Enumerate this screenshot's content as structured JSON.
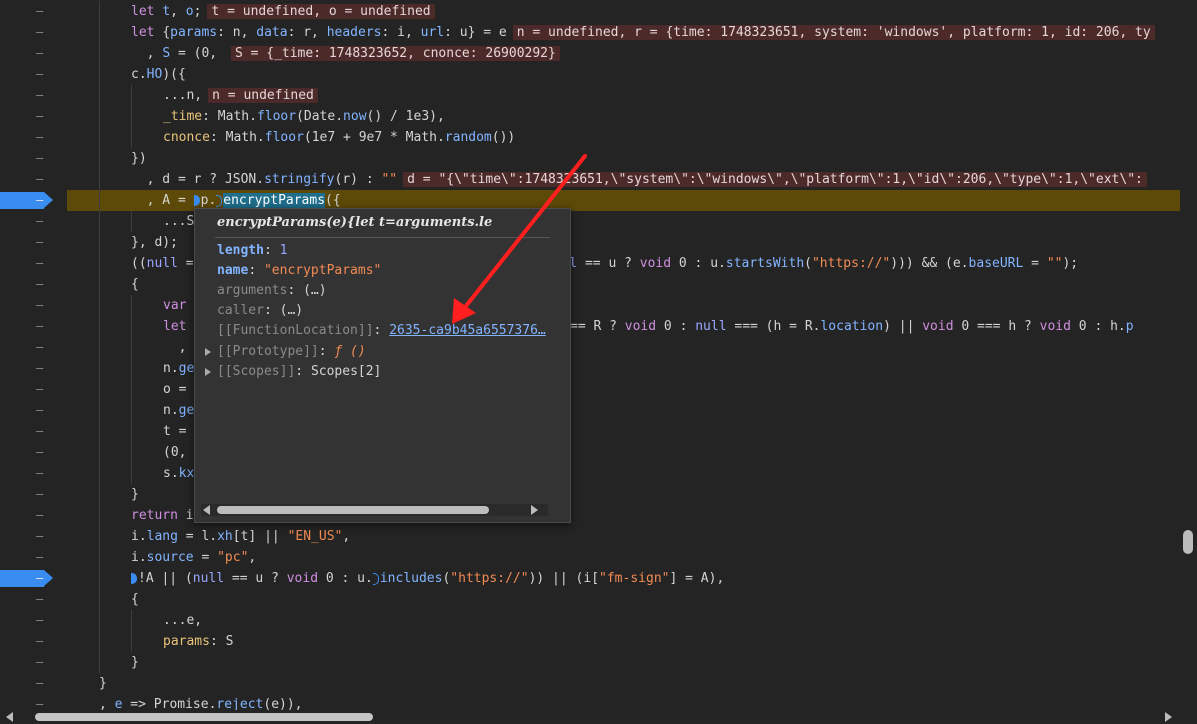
{
  "gutter": {
    "dash": "–",
    "breakpoint_lines": [
      9,
      27
    ]
  },
  "code": {
    "lines": [
      {
        "indent": 2,
        "tokens": [
          [
            "k",
            "let "
          ],
          [
            "v",
            "t"
          ],
          [
            "p",
            ", "
          ],
          [
            "v",
            "o"
          ],
          [
            "p",
            ";"
          ]
        ],
        "inline": "t = undefined, o = undefined"
      },
      {
        "indent": 2,
        "tokens": [
          [
            "k",
            "let "
          ],
          [
            "p",
            "{"
          ],
          [
            "v",
            "params"
          ],
          [
            "p",
            ": n, "
          ],
          [
            "v",
            "data"
          ],
          [
            "p",
            ": r, "
          ],
          [
            "v",
            "headers"
          ],
          [
            "p",
            ": i, "
          ],
          [
            "v",
            "url"
          ],
          [
            "p",
            ": u} = e"
          ]
        ],
        "inline": "n = undefined, r = {time: 1748323651, system: 'windows', platform: 1, id: 206, ty"
      },
      {
        "indent": 2,
        "tokens": [
          [
            "p",
            "  , "
          ],
          [
            "v",
            "S"
          ],
          [
            "p",
            " = (0, "
          ]
        ],
        "inline": "S = {_time: 1748323652, cnonce: 26900292}"
      },
      {
        "indent": 2,
        "tokens": [
          [
            "p",
            "c."
          ],
          [
            "v",
            "HO"
          ],
          [
            "p",
            ")({"
          ]
        ]
      },
      {
        "indent": 3,
        "tokens": [
          [
            "p",
            "...n,"
          ]
        ],
        "inline": "n = undefined"
      },
      {
        "indent": 3,
        "tokens": [
          [
            "f",
            "_time"
          ],
          [
            "p",
            ": Math."
          ],
          [
            "v",
            "floor"
          ],
          [
            "p",
            "(Date."
          ],
          [
            "v",
            "now"
          ],
          [
            "p",
            "() / 1e3),"
          ]
        ]
      },
      {
        "indent": 3,
        "tokens": [
          [
            "f",
            "cnonce"
          ],
          [
            "p",
            ": Math."
          ],
          [
            "v",
            "floor"
          ],
          [
            "p",
            "(1e7 + 9e7 * Math."
          ],
          [
            "v",
            "random"
          ],
          [
            "p",
            "())"
          ]
        ]
      },
      {
        "indent": 2,
        "tokens": [
          [
            "p",
            "})"
          ]
        ]
      },
      {
        "indent": 2,
        "tokens": [
          [
            "p",
            "  , d = r ? JSON."
          ],
          [
            "v",
            "stringify"
          ],
          [
            "p",
            "(r) : "
          ],
          [
            "s",
            "\"\""
          ]
        ],
        "inline": "d = \"{\\\"time\\\":1748323651,\\\"system\\\":\\\"windows\\\",\\\"platform\\\":1,\\\"id\\\":206,\\\"type\\\":1,\\\"ext\\\":"
      },
      {
        "indent": 2,
        "paused": true,
        "tokens": [
          [
            "p",
            "  , A = "
          ],
          [
            "m",
            "solid"
          ],
          [
            "p",
            "p."
          ],
          [
            "m",
            "outline"
          ],
          [
            "sel",
            "encryptParams"
          ],
          [
            "p",
            "({"
          ]
        ]
      },
      {
        "indent": 3,
        "tokens": [
          [
            "p",
            "...S"
          ]
        ]
      },
      {
        "indent": 2,
        "tokens": [
          [
            "p",
            "}, d);"
          ]
        ]
      },
      {
        "indent": 2,
        "tokens": [
          [
            "p",
            "(("
          ],
          [
            "n",
            "null"
          ],
          [
            "p",
            " =                                               "
          ],
          [
            "n",
            "ll"
          ],
          [
            "p",
            " == u ? "
          ],
          [
            "k",
            "void "
          ],
          [
            "p",
            "0 : u."
          ],
          [
            "v",
            "startsWith"
          ],
          [
            "p",
            "("
          ],
          [
            "s",
            "\"https://\""
          ],
          [
            "p",
            "))) && (e."
          ],
          [
            "v",
            "baseURL"
          ],
          [
            "p",
            " = "
          ],
          [
            "s",
            "\"\""
          ],
          [
            "p",
            ");"
          ]
        ]
      },
      {
        "indent": 2,
        "tokens": [
          [
            "p",
            "{"
          ]
        ]
      },
      {
        "indent": 3,
        "tokens": [
          [
            "k",
            "var"
          ]
        ]
      },
      {
        "indent": 3,
        "tokens": [
          [
            "k",
            "let"
          ],
          [
            "p",
            "                                            l 0 === R ? "
          ],
          [
            "k",
            "void "
          ],
          [
            "p",
            "0 : "
          ],
          [
            "n",
            "null"
          ],
          [
            "p",
            " === (h = R."
          ],
          [
            "v",
            "location"
          ],
          [
            "p",
            ") || "
          ],
          [
            "k",
            "void "
          ],
          [
            "p",
            "0 === h ? "
          ],
          [
            "k",
            "void "
          ],
          [
            "p",
            "0 : h."
          ],
          [
            "v",
            "p"
          ]
        ]
      },
      {
        "indent": 3,
        "tokens": [
          [
            "p",
            "  ,"
          ]
        ]
      },
      {
        "indent": 3,
        "tokens": [
          [
            "p",
            "n."
          ],
          [
            "v",
            "ge"
          ]
        ]
      },
      {
        "indent": 3,
        "tokens": [
          [
            "p",
            "o ="
          ]
        ]
      },
      {
        "indent": 3,
        "tokens": [
          [
            "p",
            "n."
          ],
          [
            "v",
            "ge"
          ]
        ]
      },
      {
        "indent": 3,
        "tokens": [
          [
            "p",
            "t ="
          ]
        ]
      },
      {
        "indent": 3,
        "tokens": [
          [
            "p",
            "(0,"
          ]
        ]
      },
      {
        "indent": 3,
        "tokens": [
          [
            "p",
            "s."
          ],
          [
            "v",
            "kx"
          ]
        ]
      },
      {
        "indent": 2,
        "tokens": [
          [
            "p",
            "}"
          ]
        ]
      },
      {
        "indent": 2,
        "tokens": [
          [
            "k",
            "return "
          ],
          [
            "p",
            "i"
          ]
        ]
      },
      {
        "indent": 2,
        "tokens": [
          [
            "p",
            "i."
          ],
          [
            "v",
            "lang"
          ],
          [
            "p",
            " = l."
          ],
          [
            "v",
            "xh"
          ],
          [
            "p",
            "[t] || "
          ],
          [
            "s",
            "\"EN_US\""
          ],
          [
            "p",
            ","
          ]
        ]
      },
      {
        "indent": 2,
        "tokens": [
          [
            "p",
            "i."
          ],
          [
            "v",
            "source"
          ],
          [
            "p",
            " = "
          ],
          [
            "s",
            "\"pc\""
          ],
          [
            "p",
            ","
          ]
        ]
      },
      {
        "indent": 2,
        "tokens": [
          [
            "m",
            "solid"
          ],
          [
            "p",
            "!A || ("
          ],
          [
            "n",
            "null"
          ],
          [
            "p",
            " == u ? "
          ],
          [
            "k",
            "void "
          ],
          [
            "p",
            "0 : u."
          ],
          [
            "m",
            "outline"
          ],
          [
            "v",
            "includes"
          ],
          [
            "p",
            "("
          ],
          [
            "s",
            "\"https://\""
          ],
          [
            "p",
            ")) || (i["
          ],
          [
            "s",
            "\"fm-sign\""
          ],
          [
            "p",
            "] = A),"
          ]
        ]
      },
      {
        "indent": 2,
        "tokens": [
          [
            "p",
            "{"
          ]
        ]
      },
      {
        "indent": 3,
        "tokens": [
          [
            "p",
            "...e,"
          ]
        ]
      },
      {
        "indent": 3,
        "tokens": [
          [
            "f",
            "params"
          ],
          [
            "p",
            ": S"
          ]
        ]
      },
      {
        "indent": 2,
        "tokens": [
          [
            "p",
            "}"
          ]
        ]
      },
      {
        "indent": 1,
        "tokens": [
          [
            "p",
            "}"
          ]
        ]
      },
      {
        "indent": 1,
        "tokens": [
          [
            "p",
            ", "
          ],
          [
            "v",
            "e"
          ],
          [
            "p",
            " => Promise."
          ],
          [
            "v",
            "reject"
          ],
          [
            "p",
            "(e)),"
          ]
        ]
      }
    ]
  },
  "tooltip": {
    "title": "encryptParams(e){let t=arguments.le",
    "length_key": "length",
    "length_val": "1",
    "name_key": "name",
    "name_val": "\"encryptParams\"",
    "arguments_key": "arguments",
    "arguments_val": "(…)",
    "caller_key": "caller",
    "caller_val": "(…)",
    "location_key": "[[FunctionLocation]]",
    "location_val": "2635-ca9b45a6557376…",
    "prototype_key": "[[Prototype]]",
    "prototype_val": "ƒ ()",
    "scopes_key": "[[Scopes]]",
    "scopes_val": "Scopes[2]"
  },
  "annotation": {
    "arrow_color": "#ff1f1f"
  },
  "colors": {
    "background": "#242424",
    "paused_line": "#5e4a08",
    "breakpoint": "#3a8df0"
  }
}
